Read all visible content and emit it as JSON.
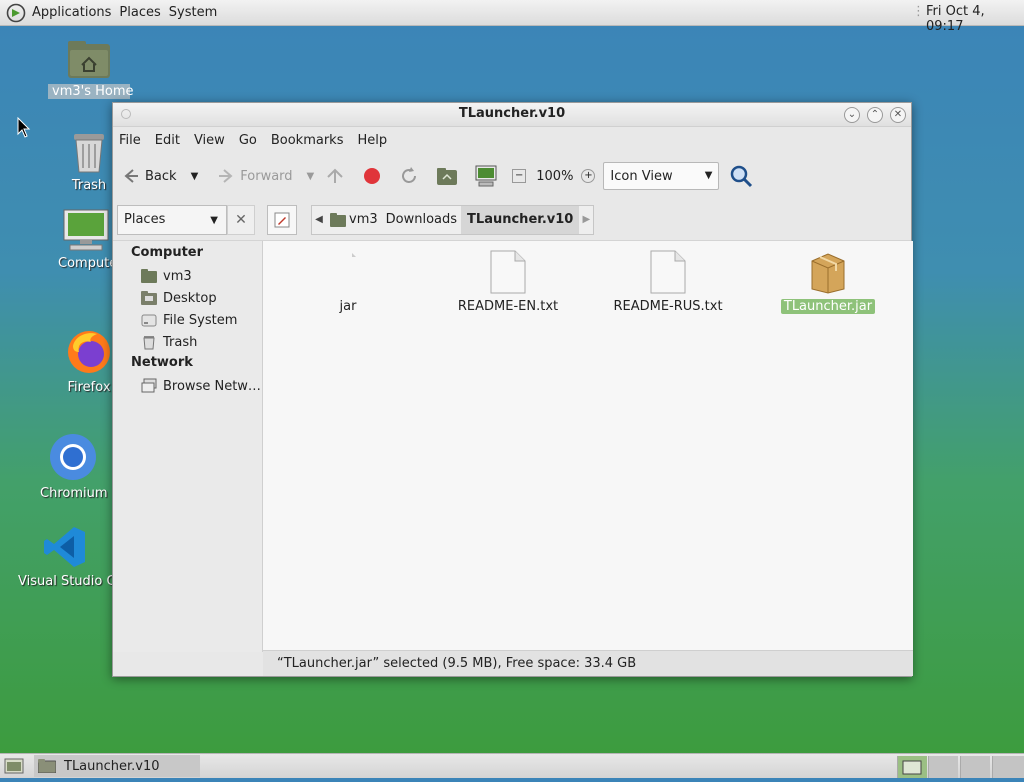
{
  "top_panel": {
    "menus": [
      "Applications",
      "Places",
      "System"
    ],
    "clock": "Fri Oct  4, 09:17"
  },
  "desktop": {
    "icons": [
      {
        "label": "vm3's Home",
        "icon": "home-folder-icon"
      },
      {
        "label": "Trash",
        "icon": "trash-icon"
      },
      {
        "label": "Compute",
        "icon": "computer-icon"
      },
      {
        "label": "Firefox",
        "icon": "firefox-icon"
      },
      {
        "label": "Chromium",
        "icon": "chromium-icon"
      },
      {
        "label": "Visual Studio C",
        "icon": "vscode-icon"
      }
    ]
  },
  "window": {
    "title": "TLauncher.v10",
    "menu": [
      "File",
      "Edit",
      "View",
      "Go",
      "Bookmarks",
      "Help"
    ],
    "toolbar": {
      "back": "Back",
      "forward": "Forward",
      "zoom": "100%",
      "view_mode": "Icon View"
    },
    "places_select": "Places",
    "path": [
      "vm3",
      "Downloads",
      "TLauncher.v10"
    ],
    "sidebar": {
      "computer_heading": "Computer",
      "computer_items": [
        "vm3",
        "Desktop",
        "File System",
        "Trash"
      ],
      "network_heading": "Network",
      "network_items": [
        "Browse Netw…"
      ]
    },
    "files": [
      {
        "name": "jar",
        "type": "broken-file-icon"
      },
      {
        "name": "README-EN.txt",
        "type": "text-file-icon"
      },
      {
        "name": "README-RUS.txt",
        "type": "text-file-icon"
      },
      {
        "name": "TLauncher.jar",
        "type": "package-icon",
        "selected": true
      }
    ],
    "status": "“TLauncher.jar” selected (9.5 MB), Free space: 33.4 GB"
  },
  "taskbar": {
    "task": "TLauncher.v10"
  },
  "colors": {
    "selection": "#8ec27a",
    "desktop_top": "#3b84b8",
    "desktop_bottom": "#3c9b3a"
  }
}
